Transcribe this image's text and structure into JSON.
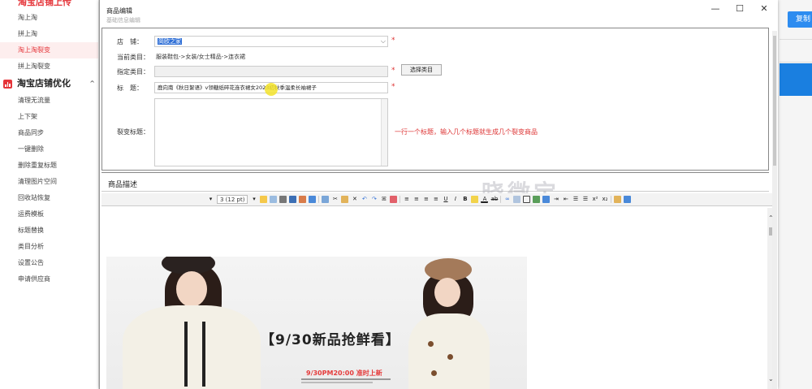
{
  "sidebar": {
    "top_section": "淘宝店铺上传",
    "top_items": [
      {
        "label": "淘上淘",
        "active": false
      },
      {
        "label": "拼上淘",
        "active": false
      },
      {
        "label": "淘上淘裂变",
        "active": true
      },
      {
        "label": "拼上淘裂变",
        "active": false
      }
    ],
    "group": {
      "label": "淘宝店铺优化",
      "chevron": "^"
    },
    "items": [
      "清理无流量",
      "上下架",
      "商品同步",
      "一键删除",
      "删除重复标题",
      "清理图片空间",
      "回收站恢复",
      "运费模板",
      "标题替换",
      "类目分析",
      "设置公告",
      "申请供应商"
    ]
  },
  "background_app": {
    "button_label": "复制"
  },
  "dialog": {
    "title": "商品编辑",
    "controls": {
      "minimize": "—",
      "maximize": "☐",
      "close": "✕"
    },
    "faded_header": "基础信息编辑",
    "store": {
      "label": "店　铺：",
      "value": "简欧之家"
    },
    "current_category": {
      "label": "当前类目：",
      "value": "服装鞋包->女装/女士精品->连衣裙"
    },
    "assign_category": {
      "label": "指定类目：",
      "value": "",
      "button": "选择类目"
    },
    "title_field": {
      "label": "标　题：",
      "value": "鹿向南《秋日絮语》v领糖纸碎花连衣裙女2023初秋季温柔长袖裙子"
    },
    "fission_title": {
      "label": "裂变标题：",
      "hint": "一行一个标题，输入几个标题就生成几个裂变商品"
    },
    "required_mark": "*",
    "description_header": "商品描述",
    "watermark": "晓微宝",
    "toolbar": {
      "font_size": "3 (12 pt)"
    },
    "banner": {
      "headline": "【9/30新品抢鲜看】",
      "subline": "9/30PM20:00 准时上新"
    }
  }
}
